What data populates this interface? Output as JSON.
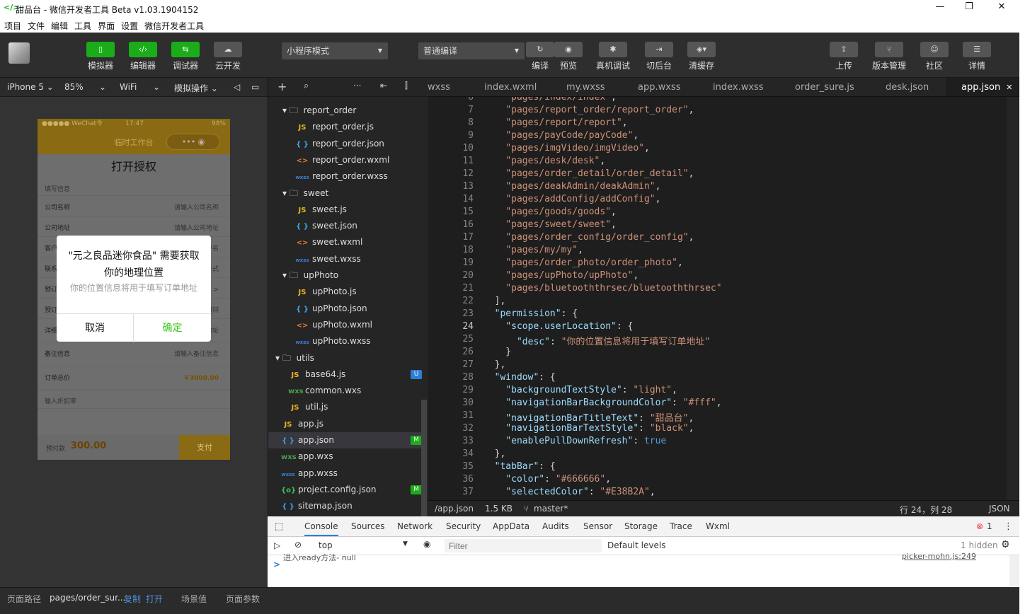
{
  "window": {
    "title": "甜品台 - 微信开发者工具 Beta v1.03.1904152",
    "minimize": "—",
    "maximize": "❐",
    "close": "✕"
  },
  "menu": [
    "项目",
    "文件",
    "编辑",
    "工具",
    "界面",
    "设置",
    "微信开发者工具"
  ],
  "toolbar": {
    "simulator": "模拟器",
    "editor": "编辑器",
    "debugger": "调试器",
    "cloud": "云开发",
    "mode": "小程序模式",
    "compile_mode": "普通编译",
    "compile": "编译",
    "preview": "预览",
    "remote_debug": "真机调试",
    "background": "切后台",
    "clear_cache": "清缓存",
    "upload": "上传",
    "version": "版本管理",
    "community": "社区",
    "details": "详情"
  },
  "device": {
    "model": "iPhone 5",
    "zoom": "85%",
    "network": "WiFi",
    "operation": "模拟操作"
  },
  "phone": {
    "status_left": "●●●●● WeChat令",
    "status_time": "17:47",
    "status_battery": "98%",
    "nav_title": "临时工作台",
    "capsule": "•••  ◉",
    "page_title": "打开授权",
    "section": "填写信息",
    "rows": [
      {
        "label": "公司名称",
        "placeholder": "请输入公司名称"
      },
      {
        "label": "公司地址",
        "placeholder": "请输入公司地址"
      },
      {
        "label": "客户",
        "placeholder": "请输入客户名"
      },
      {
        "label": "联系",
        "placeholder": "请输入联系方式"
      },
      {
        "label": "预订",
        "placeholder": "请选择 >"
      },
      {
        "label": "预订",
        "placeholder": "请选择时间"
      },
      {
        "label": "详细地址",
        "placeholder": "请输入详细地址"
      },
      {
        "label": "备注信息",
        "placeholder": "请输入备注信息"
      }
    ],
    "total_label": "订单总价",
    "total_value": "￥3000.00",
    "discount_label": "输入折扣率",
    "prepay_label": "预付款",
    "prepay_value": "300.00",
    "pay": "支付"
  },
  "dialog": {
    "title": "\"元之良品迷你食品\" 需要获取你的地理位置",
    "desc": "你的位置信息将用于填写订单地址",
    "cancel": "取消",
    "confirm": "确定"
  },
  "sim_footer": {
    "path_label": "页面路径",
    "path": "pages/order_sur...",
    "copy": "复制",
    "open": "打开",
    "scene": "场景值",
    "params": "页面参数"
  },
  "tree": [
    {
      "indent": 1,
      "kind": "folder",
      "name": "report_order"
    },
    {
      "indent": 2,
      "kind": "js",
      "name": "report_order.js"
    },
    {
      "indent": 2,
      "kind": "json",
      "name": "report_order.json"
    },
    {
      "indent": 2,
      "kind": "wxml",
      "name": "report_order.wxml"
    },
    {
      "indent": 2,
      "kind": "wxss",
      "name": "report_order.wxss"
    },
    {
      "indent": 1,
      "kind": "folder",
      "name": "sweet"
    },
    {
      "indent": 2,
      "kind": "js",
      "name": "sweet.js"
    },
    {
      "indent": 2,
      "kind": "json",
      "name": "sweet.json"
    },
    {
      "indent": 2,
      "kind": "wxml",
      "name": "sweet.wxml"
    },
    {
      "indent": 2,
      "kind": "wxss",
      "name": "sweet.wxss"
    },
    {
      "indent": 1,
      "kind": "folder",
      "name": "upPhoto"
    },
    {
      "indent": 2,
      "kind": "js",
      "name": "upPhoto.js"
    },
    {
      "indent": 2,
      "kind": "json",
      "name": "upPhoto.json"
    },
    {
      "indent": 2,
      "kind": "wxml",
      "name": "upPhoto.wxml"
    },
    {
      "indent": 2,
      "kind": "wxss",
      "name": "upPhoto.wxss"
    },
    {
      "indent": 0,
      "kind": "folder",
      "name": "utils"
    },
    {
      "indent": 1,
      "kind": "js",
      "name": "base64.js",
      "badge": "U"
    },
    {
      "indent": 1,
      "kind": "wxs",
      "name": "common.wxs"
    },
    {
      "indent": 1,
      "kind": "js",
      "name": "util.js"
    },
    {
      "indent": 0,
      "kind": "js",
      "name": "app.js"
    },
    {
      "indent": 0,
      "kind": "json",
      "name": "app.json",
      "badge": "M",
      "selected": true
    },
    {
      "indent": 0,
      "kind": "wxs",
      "name": "app.wxs"
    },
    {
      "indent": 0,
      "kind": "wxss",
      "name": "app.wxss"
    },
    {
      "indent": 0,
      "kind": "cfg",
      "name": "project.config.json",
      "badge": "M"
    },
    {
      "indent": 0,
      "kind": "json",
      "name": "sitemap.json"
    }
  ],
  "tabs": [
    "wxss",
    "index.wxml",
    "my.wxss",
    "app.wxss",
    "index.wxss",
    "order_sure.js",
    "desk.json",
    "app.json"
  ],
  "tab_close": "✕",
  "code": [
    {
      "n": "6",
      "t": "    \"pages/index/index\","
    },
    {
      "n": "7",
      "t": "    \"pages/report_order/report_order\","
    },
    {
      "n": "8",
      "t": "    \"pages/report/report\","
    },
    {
      "n": "9",
      "t": "    \"pages/payCode/payCode\","
    },
    {
      "n": "10",
      "t": "    \"pages/imgVideo/imgVideo\","
    },
    {
      "n": "11",
      "t": "    \"pages/desk/desk\","
    },
    {
      "n": "12",
      "t": "    \"pages/order_detail/order_detail\","
    },
    {
      "n": "13",
      "t": "    \"pages/deakAdmin/deakAdmin\","
    },
    {
      "n": "14",
      "t": "    \"pages/addConfig/addConfig\","
    },
    {
      "n": "15",
      "t": "    \"pages/goods/goods\","
    },
    {
      "n": "16",
      "t": "    \"pages/sweet/sweet\","
    },
    {
      "n": "17",
      "t": "    \"pages/order_config/order_config\","
    },
    {
      "n": "18",
      "t": "    \"pages/my/my\","
    },
    {
      "n": "19",
      "t": "    \"pages/order_photo/order_photo\","
    },
    {
      "n": "20",
      "t": "    \"pages/upPhoto/upPhoto\","
    },
    {
      "n": "21",
      "t": "    \"pages/bluetooththrsec/bluetooththrsec\""
    },
    {
      "n": "22",
      "t": "  ],"
    },
    {
      "n": "23",
      "t": "  \"permission\": {"
    },
    {
      "n": "24",
      "t": "    \"scope.userLocation\": {"
    },
    {
      "n": "25",
      "t": "      \"desc\": \"你的位置信息将用于填写订单地址\""
    },
    {
      "n": "26",
      "t": "    }"
    },
    {
      "n": "27",
      "t": "  },"
    },
    {
      "n": "28",
      "t": "  \"window\": {"
    },
    {
      "n": "29",
      "t": "    \"backgroundTextStyle\": \"light\","
    },
    {
      "n": "30",
      "t": "    \"navigationBarBackgroundColor\": \"#fff\","
    },
    {
      "n": "31",
      "t": "    \"navigationBarTitleText\": \"甜品台\","
    },
    {
      "n": "32",
      "t": "    \"navigationBarTextStyle\": \"black\","
    },
    {
      "n": "33",
      "t": "    \"enablePullDownRefresh\": true"
    },
    {
      "n": "34",
      "t": "  },"
    },
    {
      "n": "35",
      "t": "  \"tabBar\": {"
    },
    {
      "n": "36",
      "t": "    \"color\": \"#666666\","
    },
    {
      "n": "37",
      "t": "    \"selectedColor\": \"#E38B2A\","
    }
  ],
  "status": {
    "file": "/app.json",
    "size": "1.5 KB",
    "branch": "master*",
    "position": "行 24，列 28",
    "lang": "JSON"
  },
  "console": {
    "tabs": [
      "Console",
      "Sources",
      "Network",
      "Security",
      "AppData",
      "Audits",
      "Sensor",
      "Storage",
      "Trace",
      "Wxml"
    ],
    "error_count": "1",
    "context": "top",
    "filter_placeholder": "Filter",
    "levels": "Default levels",
    "hidden": "1 hidden",
    "log_text": "进入ready方法- null",
    "log_source": "picker-mohn.js:249",
    "prompt": ">"
  },
  "colors": {
    "accent": "#1aad19",
    "selected_row": "#37373d",
    "modified": "#1aad19",
    "untracked": "#2d7fd6"
  }
}
